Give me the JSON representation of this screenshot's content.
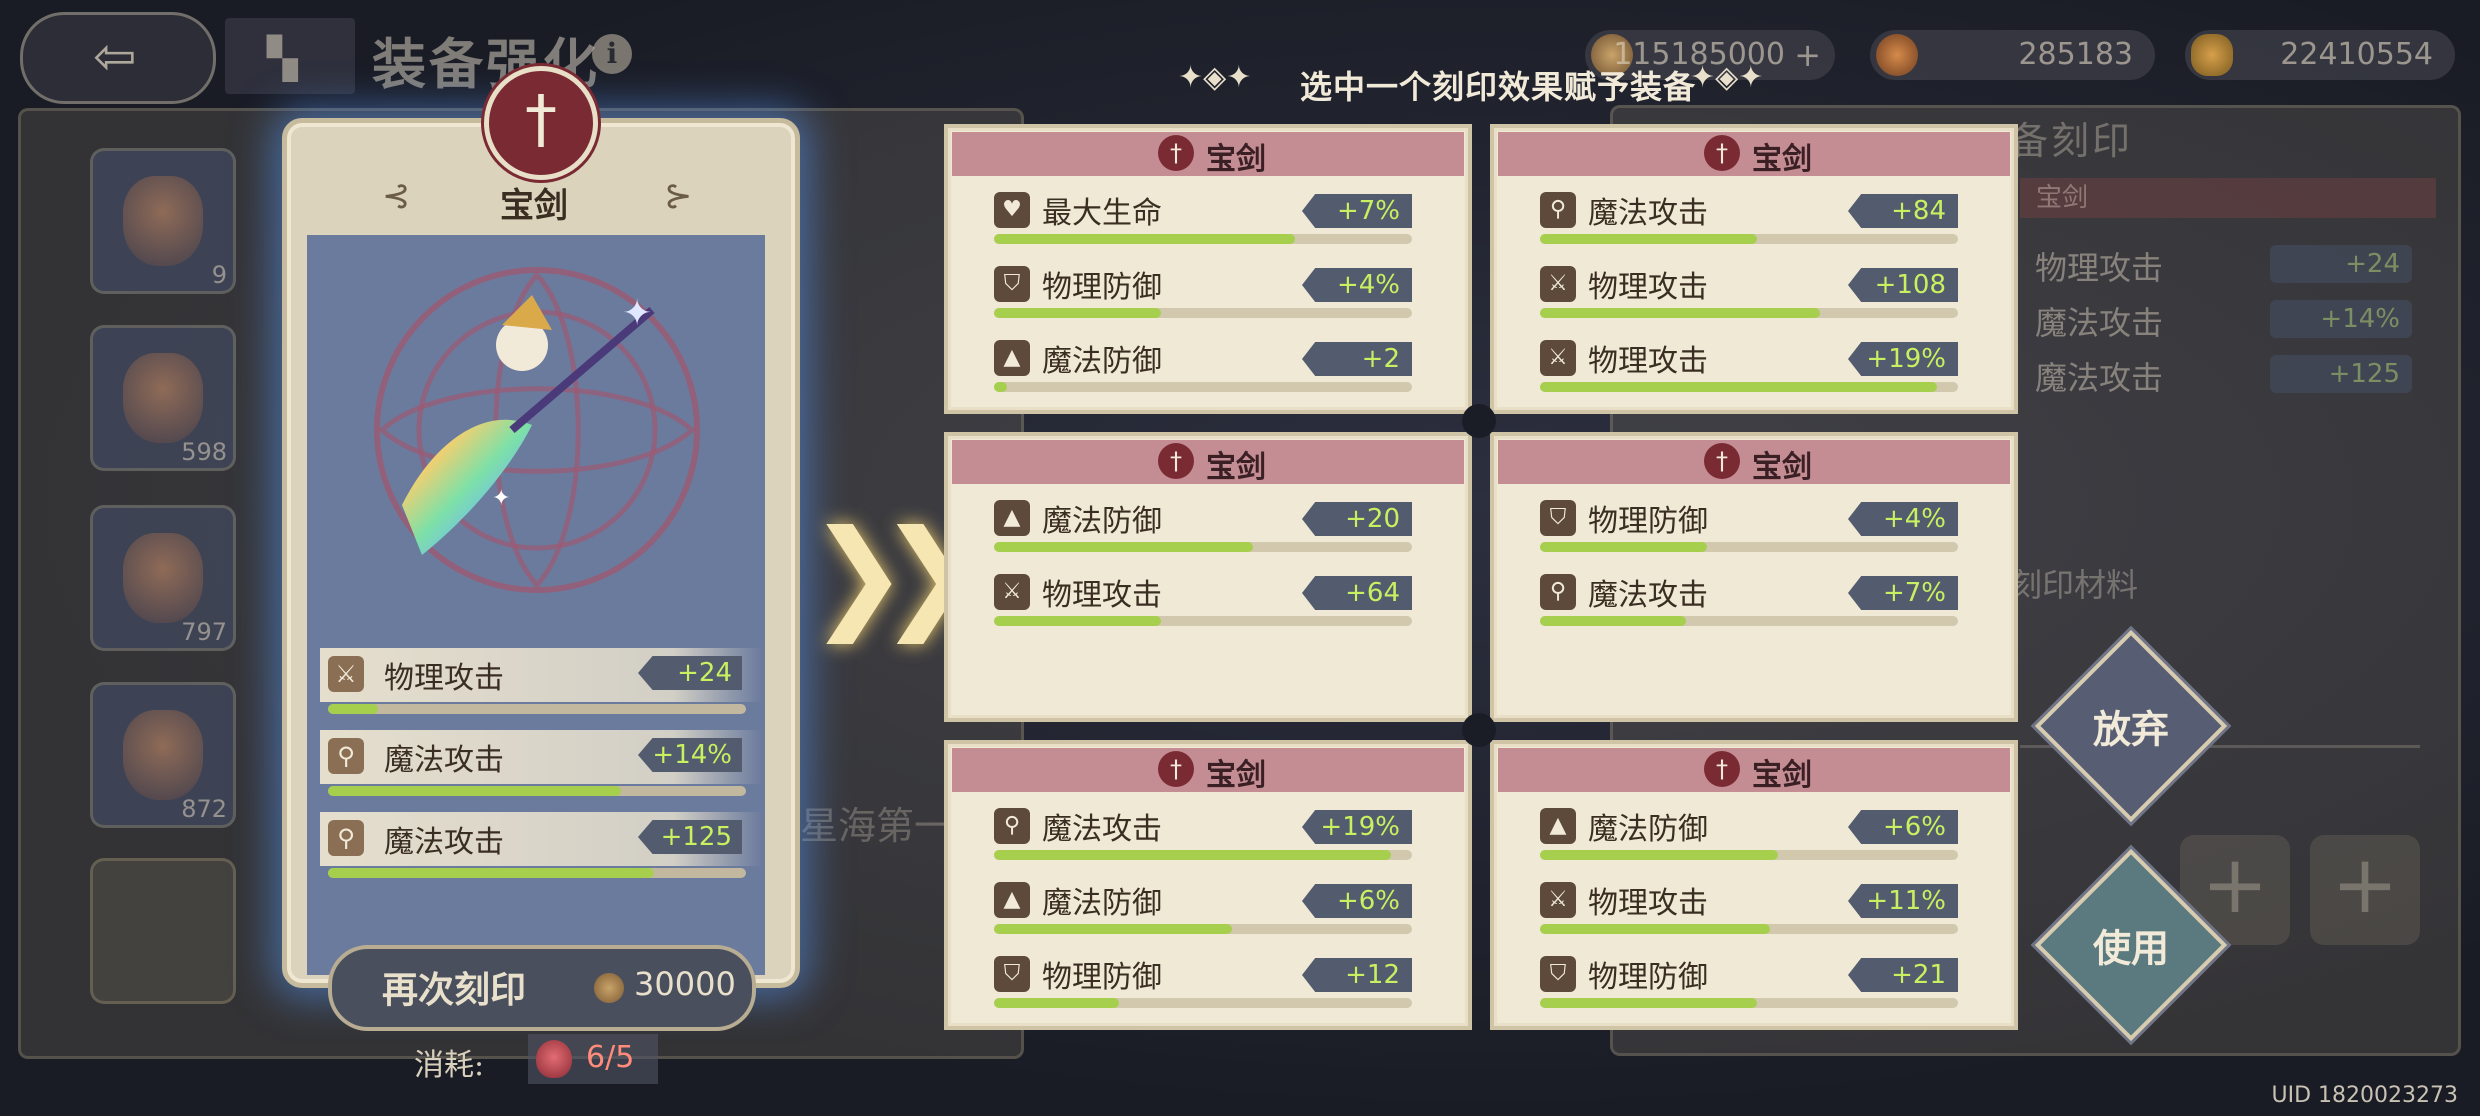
{
  "header": {
    "title": "装备强化",
    "instruction": "选中一个刻印效果赋予装备",
    "currencies": [
      {
        "icon": "gold-coin-icon",
        "value": "115185000"
      },
      {
        "icon": "planet-icon",
        "value": "285183"
      },
      {
        "icon": "material-icon",
        "value": "22410554"
      }
    ]
  },
  "equipment": {
    "name": "宝剑",
    "icon": "sword-icon",
    "stats": [
      {
        "icon": "sword-icon",
        "label": "物理攻击",
        "value": "+24",
        "fill": 0.12
      },
      {
        "icon": "wand-icon",
        "label": "魔法攻击",
        "value": "+14%",
        "fill": 0.7
      },
      {
        "icon": "wand-icon",
        "label": "魔法攻击",
        "value": "+125",
        "fill": 0.78
      }
    ],
    "reengrave": {
      "label": "再次刻印",
      "cost": "30000"
    },
    "consume": {
      "label": "消耗:",
      "value": "6/5"
    }
  },
  "options": [
    {
      "name": "宝剑",
      "stats": [
        {
          "icon": "heart-icon",
          "label": "最大生命",
          "value": "+7%",
          "fill": 0.72
        },
        {
          "icon": "shield-icon",
          "label": "物理防御",
          "value": "+4%",
          "fill": 0.4
        },
        {
          "icon": "wizard-hat-icon",
          "label": "魔法防御",
          "value": "+2",
          "fill": 0.03
        }
      ]
    },
    {
      "name": "宝剑",
      "stats": [
        {
          "icon": "wand-icon",
          "label": "魔法攻击",
          "value": "+84",
          "fill": 0.52
        },
        {
          "icon": "sword-icon",
          "label": "物理攻击",
          "value": "+108",
          "fill": 0.67
        },
        {
          "icon": "sword-icon",
          "label": "物理攻击",
          "value": "+19%",
          "fill": 0.95
        }
      ]
    },
    {
      "name": "宝剑",
      "stats": [
        {
          "icon": "wizard-hat-icon",
          "label": "魔法防御",
          "value": "+20",
          "fill": 0.62
        },
        {
          "icon": "sword-icon",
          "label": "物理攻击",
          "value": "+64",
          "fill": 0.4
        }
      ]
    },
    {
      "name": "宝剑",
      "stats": [
        {
          "icon": "shield-icon",
          "label": "物理防御",
          "value": "+4%",
          "fill": 0.4
        },
        {
          "icon": "wand-icon",
          "label": "魔法攻击",
          "value": "+7%",
          "fill": 0.35
        }
      ]
    },
    {
      "name": "宝剑",
      "stats": [
        {
          "icon": "wand-icon",
          "label": "魔法攻击",
          "value": "+19%",
          "fill": 0.95
        },
        {
          "icon": "wizard-hat-icon",
          "label": "魔法防御",
          "value": "+6%",
          "fill": 0.57
        },
        {
          "icon": "shield-icon",
          "label": "物理防御",
          "value": "+12",
          "fill": 0.3
        }
      ]
    },
    {
      "name": "宝剑",
      "stats": [
        {
          "icon": "wizard-hat-icon",
          "label": "魔法防御",
          "value": "+6%",
          "fill": 0.57
        },
        {
          "icon": "sword-icon",
          "label": "物理攻击",
          "value": "+11%",
          "fill": 0.55
        },
        {
          "icon": "shield-icon",
          "label": "物理防御",
          "value": "+21",
          "fill": 0.52
        }
      ]
    }
  ],
  "actions": {
    "abandon": "放弃",
    "use": "使用"
  },
  "background": {
    "slot_counts": [
      "9",
      "598",
      "797",
      "872"
    ],
    "right_title": "备刻印",
    "right_subtitle": "宝剑",
    "right_stats": [
      {
        "label": "物理攻击",
        "value": "+24"
      },
      {
        "label": "魔法攻击",
        "value": "+14%"
      },
      {
        "label": "魔法攻击",
        "value": "+125"
      }
    ],
    "material_label": "刻印材料",
    "mid_text": "星海第一"
  },
  "uid": "UID 1820023273",
  "colors": {
    "accent_green": "#c8f060",
    "card_bg": "#f0e9d6",
    "header_pink": "#c48c93",
    "emblem_red": "#7a2a33",
    "glow_blue": "#5a96f0"
  }
}
